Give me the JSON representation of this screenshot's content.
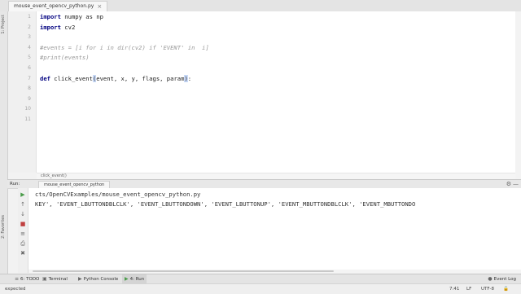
{
  "file_tab": {
    "label": "mouse_event_opencv_python.py",
    "close": "×"
  },
  "left_strip": {
    "top_label": "1: Project",
    "bottom_label": "2: Favorites"
  },
  "editor": {
    "line_numbers": [
      "1",
      "2",
      "3",
      "4",
      "5",
      "6",
      "7",
      "8",
      "9",
      "10",
      "11"
    ],
    "code": [
      {
        "kw": "import",
        "rest": " numpy as np"
      },
      {
        "kw": "import",
        "rest": " cv2"
      },
      {
        "comment": "#events = [i for i in dir(cv2) if 'EVENT' in  i]"
      },
      {
        "comment": "#print(events)"
      },
      {
        "kw": "def",
        "name": " click_event",
        "paren": "(",
        "args": "event, x, y, flags, param",
        "close": ")",
        "colon": ":"
      }
    ]
  },
  "breadcrumb": "click_event()",
  "run_panel": {
    "label": "Run:",
    "tab": "mouse_event_opencv_python",
    "gear": "⚙",
    "minimize": "—",
    "console_lines": [
      "cts/OpenCVExamples/mouse_event_opencv_python.py",
      "KEY', 'EVENT_LBUTTONDBLCLK', 'EVENT_LBUTTONDOWN', 'EVENT_LBUTTONUP', 'EVENT_MBUTTONDBLCLK', 'EVENT_MBUTTONDO"
    ]
  },
  "tool_windows": [
    {
      "icon": "≡",
      "label": "6: TODO"
    },
    {
      "icon": "▣",
      "label": "Terminal"
    },
    {
      "icon": "▶",
      "label": "Python Console"
    },
    {
      "icon": "▶",
      "label": "4: Run"
    }
  ],
  "event_log": "Event Log",
  "status": {
    "left": "expected",
    "position": "7:41",
    "line_sep": "LF",
    "encoding": "UTF-8"
  }
}
